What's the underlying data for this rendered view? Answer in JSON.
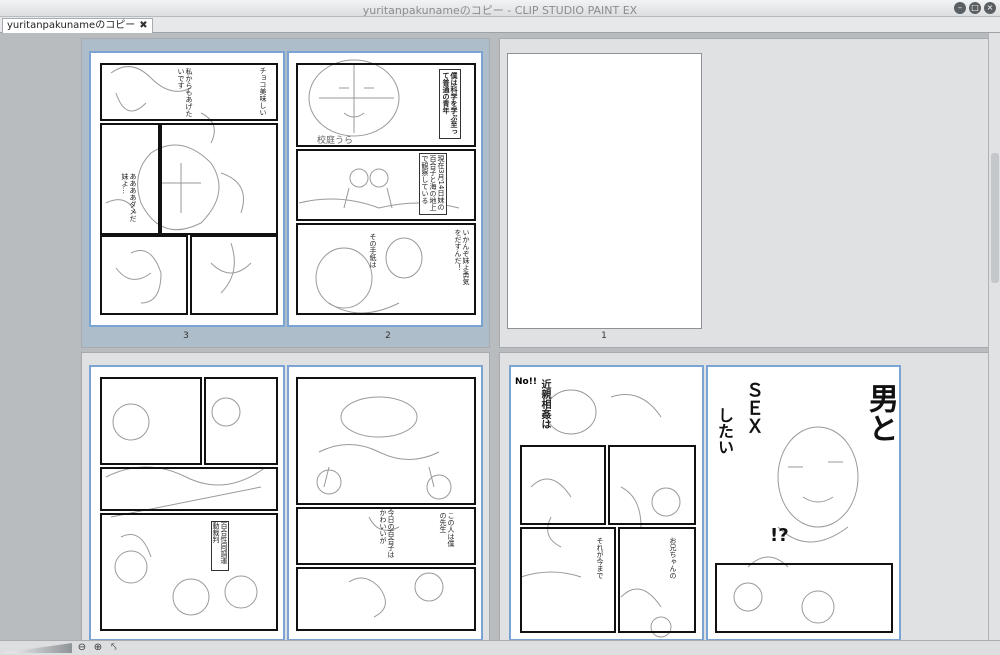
{
  "window": {
    "title": "yuritanpakunameのコピー - CLIP STUDIO PAINT EX"
  },
  "tab": {
    "label": "yuritanpakunameのコピー",
    "close": "✖"
  },
  "pages": {
    "p3": "3",
    "p2": "2",
    "p1": "1"
  },
  "manga_text": {
    "p2_title": "僕は科学を学ぶ至って普通の青年",
    "p2_note": "校庭うら",
    "p2_b1": "現在3月14日妹の百合子と海の地上で観察している",
    "p2_b2": "いかんぞ妹よ勇気をだすんだ！",
    "p2_b3": "その手紙は",
    "p3_b1": "私からもあげたいです",
    "p3_b2": "ああああダメだ妹よ…",
    "p3_b3": "チョコ美味しい",
    "p5_b1": "今日の百合子はかわいいが",
    "p5_b2": "この人は僕の先生",
    "p5_b3": "百合性同調運動裁判",
    "p4_title1": "近親相姦は",
    "p4_title2": "No!!",
    "p4_b1": "それが今まで",
    "p4_b2": "お兄ちゃんの",
    "big_sex": "ＳＥＸ",
    "big_shitai": "したい",
    "big_otoko": "男と",
    "big_q": "!?"
  },
  "icons": {
    "win_min": "minimize-icon",
    "win_max": "maximize-icon",
    "win_close": "close-icon",
    "zoom_out": "zoom-out-icon",
    "zoom_in": "zoom-in-icon",
    "rotate": "rotate-icon"
  },
  "status": {
    "zoom_out_glyph": "⊖",
    "zoom_in_glyph": "⊕",
    "rotate_glyph": "⤣"
  }
}
